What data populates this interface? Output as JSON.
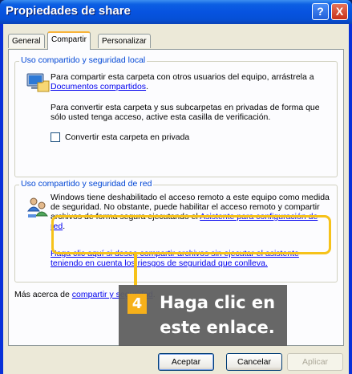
{
  "window": {
    "title": "Propiedades de share",
    "help_label": "?",
    "close_label": "X"
  },
  "tabs": [
    {
      "label": "General",
      "active": false
    },
    {
      "label": "Compartir",
      "active": true
    },
    {
      "label": "Personalizar",
      "active": false
    }
  ],
  "local_group": {
    "legend": "Uso compartido y seguridad local",
    "text1": "Para compartir esta carpeta con otros usuarios del equipo, arrástrela a ",
    "link": "Documentos compartidos",
    "text1_end": ".",
    "text2": "Para convertir esta carpeta y sus subcarpetas en privadas de forma que sólo usted tenga acceso, active esta casilla de verificación.",
    "checkbox_label": "Convertir esta carpeta en privada",
    "checkbox_checked": false
  },
  "network_group": {
    "legend": "Uso compartido y seguridad de red",
    "text": "Windows tiene deshabilitado el acceso remoto a este equipo como medida de seguridad. No obstante, puede habilitar el acceso remoto y compartir archivos de forma segura ejecutando el ",
    "wizard_link": "Asistente para configuración de red",
    "text_end": ".",
    "risk_link": "Haga clic aquí si desea compartir archivos sin ejecutar el asistente teniendo en cuenta los riesgos de seguridad que conlleva."
  },
  "more_info": {
    "text": "Más acerca de ",
    "link": "compartir y seguridad",
    "end": "."
  },
  "buttons": {
    "ok": "Aceptar",
    "cancel": "Cancelar",
    "apply": "Aplicar"
  },
  "callout": {
    "step": "4",
    "text": "Haga clic en este enlace.",
    "accent": "#f6b01a"
  }
}
